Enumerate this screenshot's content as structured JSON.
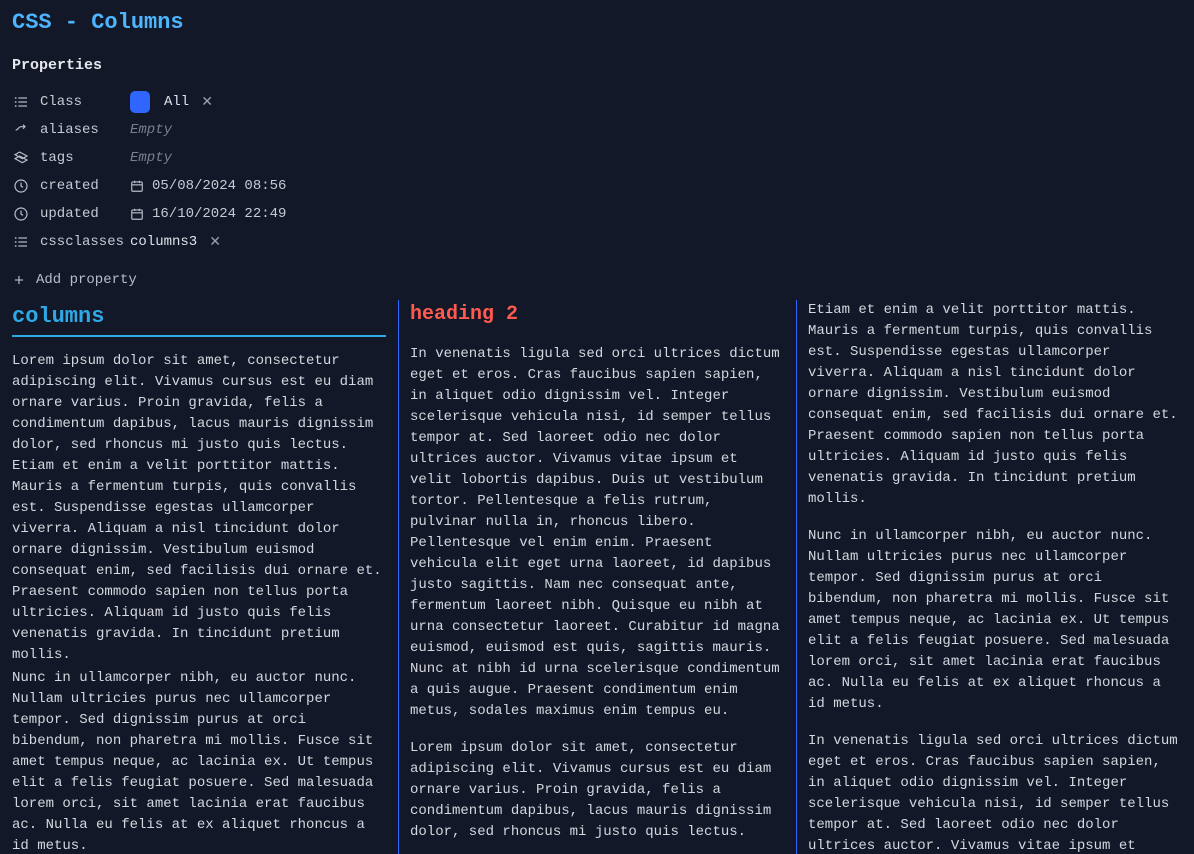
{
  "title": "CSS - Columns",
  "properties_label": "Properties",
  "meta": {
    "class": {
      "key": "Class",
      "value": "All",
      "has_pill": true,
      "has_badge": true
    },
    "aliases": {
      "key": "aliases",
      "value": "Empty",
      "empty": true
    },
    "tags": {
      "key": "tags",
      "value": "Empty",
      "empty": true
    },
    "created": {
      "key": "created",
      "value": "05/08/2024 08:56",
      "date": true
    },
    "updated": {
      "key": "updated",
      "value": "16/10/2024 22:49",
      "date": true
    },
    "cssclasses": {
      "key": "cssclasses",
      "value": "columns3",
      "has_pill": true
    }
  },
  "add_property_label": "Add property",
  "content": {
    "h1": "columns",
    "p1": "Lorem ipsum dolor sit amet, consectetur adipiscing elit. Vivamus cursus est eu diam ornare varius. Proin gravida, felis a condimentum dapibus, lacus mauris dignissim dolor, sed rhoncus mi justo quis lectus. Etiam et enim a velit porttitor mattis. Mauris a fermentum turpis, quis convallis est. Suspendisse egestas ullamcorper viverra. Aliquam a nisl tincidunt dolor ornare dignissim. Vestibulum euismod consequat enim, sed facilisis dui ornare et. Praesent commodo sapien non tellus porta ultricies. Aliquam id justo quis felis venenatis gravida. In tincidunt pretium mollis.",
    "p2": "Nunc in ullamcorper nibh, eu auctor nunc. Nullam ultricies purus nec ullamcorper tempor. Sed dignissim purus at orci bibendum, non pharetra mi mollis. Fusce sit amet tempus neque, ac lacinia ex. Ut tempus elit a felis feugiat posuere. Sed malesuada lorem orci, sit amet lacinia erat faucibus ac. Nulla eu felis at ex aliquet rhoncus a id metus.",
    "h2": "heading 2",
    "p3": "In venenatis ligula sed orci ultrices dictum eget et eros. Cras faucibus sapien sapien, in aliquet odio dignissim vel. Integer scelerisque vehicula nisi, id semper tellus tempor at. Sed laoreet odio nec dolor ultrices auctor. Vivamus vitae ipsum et velit lobortis dapibus. Duis ut vestibulum tortor. Pellentesque a felis rutrum, pulvinar nulla in, rhoncus libero. Pellentesque vel enim enim. Praesent vehicula elit eget urna laoreet, id dapibus justo sagittis. Nam nec consequat ante, fermentum laoreet nibh. Quisque eu nibh at urna consectetur laoreet. Curabitur id magna euismod, euismod est quis, sagittis mauris. Nunc at nibh id urna scelerisque condimentum a quis augue. Praesent condimentum enim metus, sodales maximus enim tempus eu.",
    "p4": "Lorem ipsum dolor sit amet, consectetur adipiscing elit. Vivamus cursus est eu diam ornare varius. Proin gravida, felis a condimentum dapibus, lacus mauris dignissim dolor, sed rhoncus mi justo quis lectus. Etiam et enim a velit porttitor mattis. Mauris a fermentum turpis, quis convallis est. Suspendisse egestas ullamcorper viverra. Aliquam a nisl tincidunt dolor ornare dignissim. Vestibulum euismod consequat enim, sed facilisis dui ornare et. Praesent commodo sapien non tellus porta ultricies. Aliquam id justo quis felis venenatis gravida. In tincidunt pretium mollis.",
    "p5": "Nunc in ullamcorper nibh, eu auctor nunc. Nullam ultricies purus nec ullamcorper tempor. Sed dignissim purus at orci bibendum, non pharetra mi mollis. Fusce sit amet tempus neque, ac lacinia ex. Ut tempus elit a felis feugiat posuere. Sed malesuada lorem orci, sit amet lacinia erat faucibus ac. Nulla eu felis at ex aliquet rhoncus a id metus.",
    "p6": "In venenatis ligula sed orci ultrices dictum eget et eros. Cras faucibus sapien sapien, in aliquet odio dignissim vel. Integer scelerisque vehicula nisi, id semper tellus tempor at. Sed laoreet odio nec dolor ultrices auctor. Vivamus vitae ipsum et velit lobortis dapibus. Duis ut vestibulum tortor. Pellentesque a felis rutrum, pulvinar nulla in, rhoncus libero. Pellentesque vel enim enim. Praesent vehicula elit eget urna laoreet, id dapibus justo sagittis. Nam nec consequat ante, fermentum laoreet nibh. Quisque eu nibh at urna consectetur laoreet. Curabitur id magna euismod, euismod est quis, sagittis mauris. Nunc at nibh id urna scelerisque condimentum a quis augue. Praesent condimentum enim metus, sodales maximus enim tempus eu."
  }
}
